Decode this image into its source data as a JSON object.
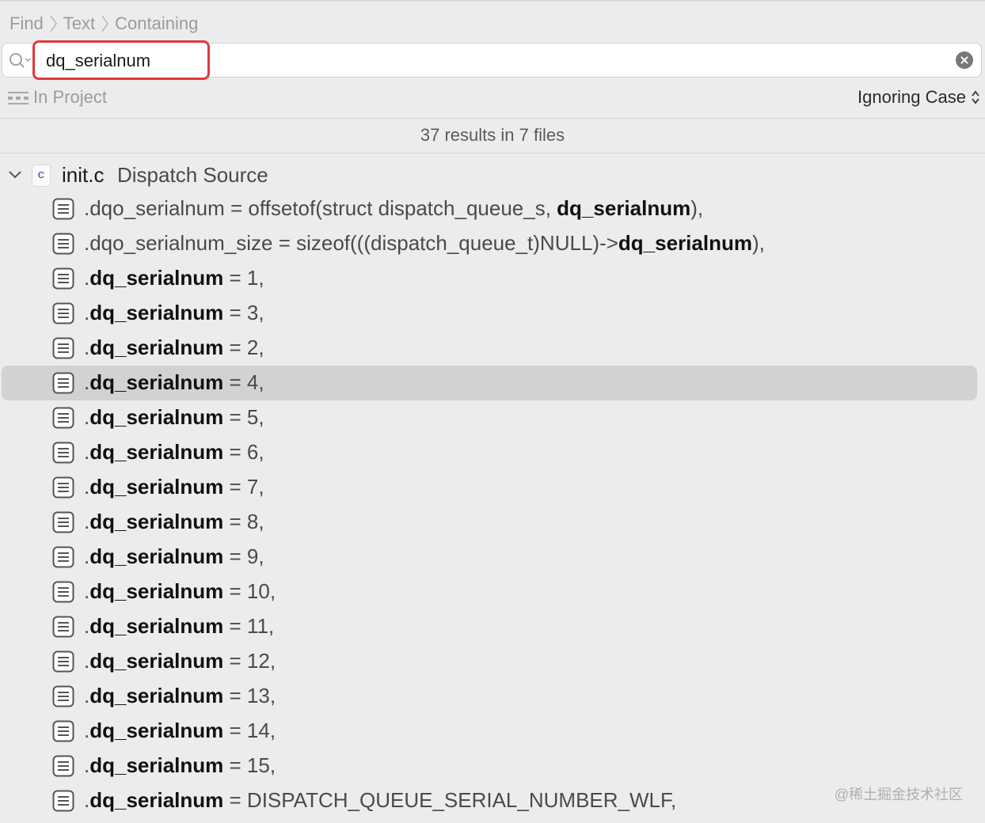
{
  "breadcrumb": {
    "items": [
      "Find",
      "Text",
      "Containing"
    ]
  },
  "search": {
    "value": "dq_serialnum",
    "placeholder": ""
  },
  "options": {
    "scope": "In Project",
    "case_mode": "Ignoring Case"
  },
  "summary": "37 results in 7 files",
  "file": {
    "name": "init.c",
    "description": "Dispatch Source",
    "icon_letter": "c"
  },
  "results": [
    {
      "before": ".dqo_serialnum = offsetof(struct dispatch_queue_s, ",
      "match": "dq_serialnum",
      "after": "),",
      "selected": false
    },
    {
      "before": ".dqo_serialnum_size = sizeof(((dispatch_queue_t)NULL)->",
      "match": "dq_serialnum",
      "after": "),",
      "selected": false
    },
    {
      "before": ".",
      "match": "dq_serialnum",
      "after": " = 1,",
      "selected": false
    },
    {
      "before": ".",
      "match": "dq_serialnum",
      "after": " = 3,",
      "selected": false
    },
    {
      "before": ".",
      "match": "dq_serialnum",
      "after": " = 2,",
      "selected": false
    },
    {
      "before": ".",
      "match": "dq_serialnum",
      "after": " = 4,",
      "selected": true
    },
    {
      "before": ".",
      "match": "dq_serialnum",
      "after": " = 5,",
      "selected": false
    },
    {
      "before": ".",
      "match": "dq_serialnum",
      "after": " = 6,",
      "selected": false
    },
    {
      "before": ".",
      "match": "dq_serialnum",
      "after": " = 7,",
      "selected": false
    },
    {
      "before": ".",
      "match": "dq_serialnum",
      "after": " = 8,",
      "selected": false
    },
    {
      "before": ".",
      "match": "dq_serialnum",
      "after": " = 9,",
      "selected": false
    },
    {
      "before": ".",
      "match": "dq_serialnum",
      "after": " = 10,",
      "selected": false
    },
    {
      "before": ".",
      "match": "dq_serialnum",
      "after": " = 11,",
      "selected": false
    },
    {
      "before": ".",
      "match": "dq_serialnum",
      "after": " = 12,",
      "selected": false
    },
    {
      "before": ".",
      "match": "dq_serialnum",
      "after": " = 13,",
      "selected": false
    },
    {
      "before": ".",
      "match": "dq_serialnum",
      "after": " = 14,",
      "selected": false
    },
    {
      "before": ".",
      "match": "dq_serialnum",
      "after": " = 15,",
      "selected": false
    },
    {
      "before": ".",
      "match": "dq_serialnum",
      "after": " = DISPATCH_QUEUE_SERIAL_NUMBER_WLF,",
      "selected": false
    }
  ],
  "watermark": "@稀土掘金技术社区",
  "icons": {
    "search": "magnifier-icon",
    "clear": "clear-circle-icon",
    "scope": "scope-icon",
    "updown": "up-down-chevron-icon",
    "disclosure": "chevron-down-icon",
    "file": "c-file-icon",
    "line": "text-line-icon"
  },
  "colors": {
    "highlight_border": "#e0393e",
    "selected_row": "#d2d2d2",
    "background": "#ececec"
  }
}
